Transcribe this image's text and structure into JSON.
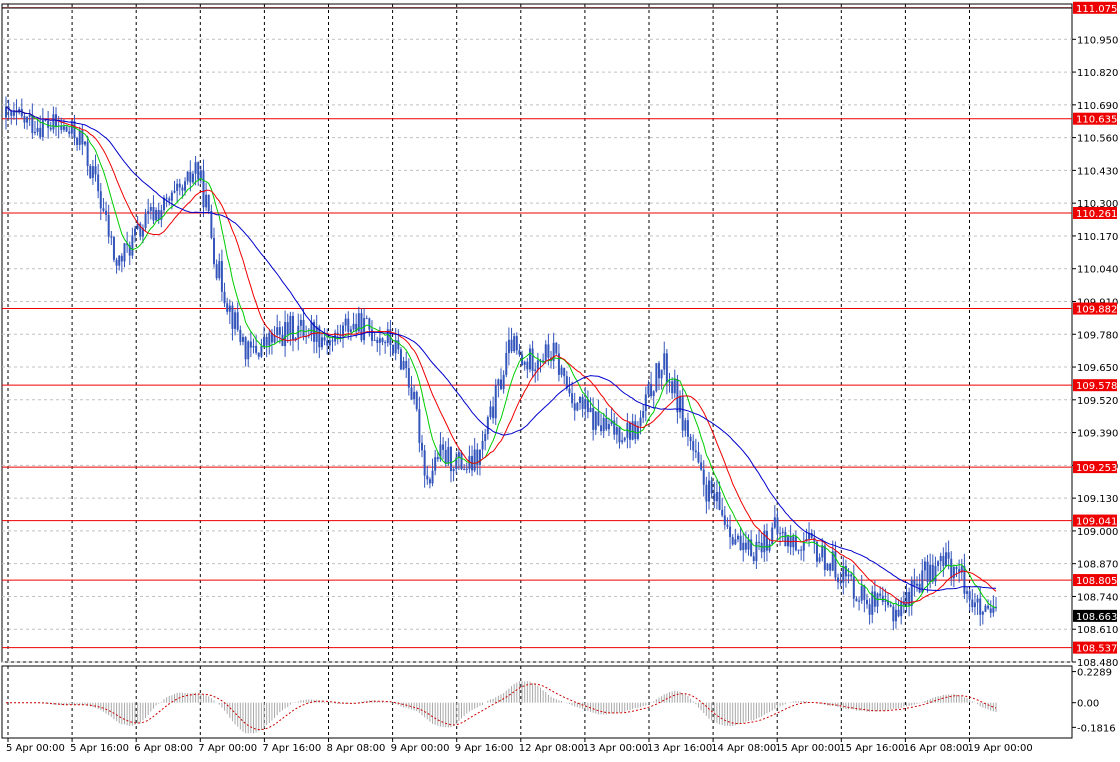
{
  "chart_data": {
    "type": "candlestick",
    "instrument_hint": "",
    "colors": {
      "candle": "#3355bb",
      "level_line": "#ee0000",
      "level_label_bg": "#ee0000",
      "ma_fast": "#00cc00",
      "ma_mid": "#ee0000",
      "ma_slow": "#0000cc",
      "grid": "#000000",
      "osc_bars": "#a8a8a8",
      "osc_signal": "#cc0000",
      "current_label_bg": "#000000"
    },
    "main": {
      "ylim": [
        108.48,
        111.09
      ],
      "y_ticks": [
        "110.950",
        "110.820",
        "110.690",
        "110.560",
        "110.430",
        "110.300",
        "110.170",
        "110.040",
        "109.910",
        "109.780",
        "109.650",
        "109.520",
        "109.390",
        "109.260",
        "109.130",
        "109.000",
        "108.870",
        "108.740",
        "108.610",
        "108.480"
      ],
      "levels": [
        {
          "value": 111.075,
          "label": "111.075"
        },
        {
          "value": 110.635,
          "label": "110.635"
        },
        {
          "value": 110.261,
          "label": "110.261"
        },
        {
          "value": 109.882,
          "label": "109.882"
        },
        {
          "value": 109.578,
          "label": "109.578"
        },
        {
          "value": 109.253,
          "label": "109.253"
        },
        {
          "value": 109.041,
          "label": "109.041"
        },
        {
          "value": 108.805,
          "label": "108.805"
        },
        {
          "value": 108.537,
          "label": "108.537"
        }
      ],
      "current_price": {
        "value": 108.663,
        "label": "108.663"
      },
      "anchors": [
        [
          0,
          110.64
        ],
        [
          10,
          110.62
        ],
        [
          20,
          110.6
        ],
        [
          28,
          110.56
        ],
        [
          35,
          110.35
        ],
        [
          42,
          110.05
        ],
        [
          48,
          110.15
        ],
        [
          55,
          110.25
        ],
        [
          62,
          110.3
        ],
        [
          68,
          110.35
        ],
        [
          72,
          110.45
        ],
        [
          76,
          110.3
        ],
        [
          80,
          110.05
        ],
        [
          86,
          109.85
        ],
        [
          92,
          109.7
        ],
        [
          100,
          109.75
        ],
        [
          108,
          109.8
        ],
        [
          116,
          109.8
        ],
        [
          124,
          109.75
        ],
        [
          130,
          109.82
        ],
        [
          138,
          109.8
        ],
        [
          146,
          109.75
        ],
        [
          152,
          109.65
        ],
        [
          156,
          109.45
        ],
        [
          160,
          109.2
        ],
        [
          164,
          109.3
        ],
        [
          170,
          109.28
        ],
        [
          176,
          109.25
        ],
        [
          180,
          109.3
        ],
        [
          184,
          109.45
        ],
        [
          188,
          109.6
        ],
        [
          192,
          109.75
        ],
        [
          196,
          109.65
        ],
        [
          202,
          109.7
        ],
        [
          208,
          109.7
        ],
        [
          214,
          109.55
        ],
        [
          218,
          109.5
        ],
        [
          222,
          109.45
        ],
        [
          228,
          109.4
        ],
        [
          234,
          109.4
        ],
        [
          240,
          109.4
        ],
        [
          246,
          109.6
        ],
        [
          250,
          109.65
        ],
        [
          254,
          109.55
        ],
        [
          260,
          109.35
        ],
        [
          264,
          109.2
        ],
        [
          270,
          109.1
        ],
        [
          276,
          109.0
        ],
        [
          280,
          108.9
        ],
        [
          286,
          108.95
        ],
        [
          292,
          109.0
        ],
        [
          298,
          108.95
        ],
        [
          304,
          108.95
        ],
        [
          310,
          108.9
        ],
        [
          316,
          108.85
        ],
        [
          322,
          108.78
        ],
        [
          328,
          108.72
        ],
        [
          334,
          108.68
        ],
        [
          340,
          108.7
        ],
        [
          346,
          108.8
        ],
        [
          352,
          108.85
        ],
        [
          358,
          108.88
        ],
        [
          364,
          108.8
        ],
        [
          368,
          108.7
        ],
        [
          372,
          108.65
        ],
        [
          376,
          108.67
        ]
      ],
      "n_candles": 377,
      "ma_periods": [
        10,
        20,
        40
      ]
    },
    "oscillator": {
      "ylim": [
        -0.26,
        0.27
      ],
      "y_ticks": [
        "0.2289",
        "0.00",
        "-0.1816"
      ]
    },
    "x_labels": [
      "5 Apr 00:00",
      "5 Apr 16:00",
      "6 Apr 08:00",
      "7 Apr 00:00",
      "7 Apr 16:00",
      "8 Apr 08:00",
      "9 Apr 00:00",
      "9 Apr 16:00",
      "12 Apr 08:00",
      "13 Apr 00:00",
      "13 Apr 16:00",
      "14 Apr 08:00",
      "15 Apr 00:00",
      "15 Apr 16:00",
      "16 Apr 08:00",
      "19 Apr 00:00"
    ]
  }
}
